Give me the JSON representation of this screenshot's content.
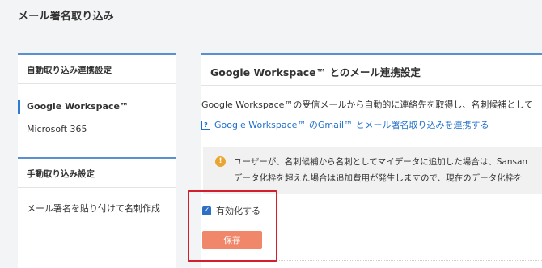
{
  "page": {
    "title": "メール署名取り込み"
  },
  "sidebar": {
    "sections": [
      {
        "title": "自動取り込み連携設定",
        "items": [
          {
            "label": "Google Workspace™",
            "active": true
          },
          {
            "label": "Microsoft 365",
            "active": false
          }
        ]
      },
      {
        "title": "手動取り込み設定",
        "items": [
          {
            "label": "メール署名を貼り付けて名刺作成",
            "active": false
          }
        ]
      }
    ]
  },
  "main": {
    "title": "Google Workspace™ とのメール連携設定",
    "description": "Google Workspace™の受信メールから自動的に連絡先を取得し、名刺候補として",
    "help_link": "Google Workspace™ のGmail™ とメール署名取り込みを連携する",
    "notice": {
      "line1": "ユーザーが、名刺候補から名刺としてマイデータに追加した場合は、Sansan",
      "line2": "データ化枠を超えた場合は追加費用が発生しますので、現在のデータ化枠を"
    },
    "enable_checkbox": {
      "label": "有効化する",
      "checked": true
    },
    "save_label": "保存"
  },
  "colors": {
    "accent": "#2d7bd6",
    "link": "#1f6fc9",
    "save_button": "#f0876a",
    "highlight": "#d41e2e",
    "warning": "#e8a530"
  },
  "icons": {
    "help": "help-square-icon",
    "notice": "warning-circle-icon",
    "checkbox": "checkmark-icon"
  }
}
